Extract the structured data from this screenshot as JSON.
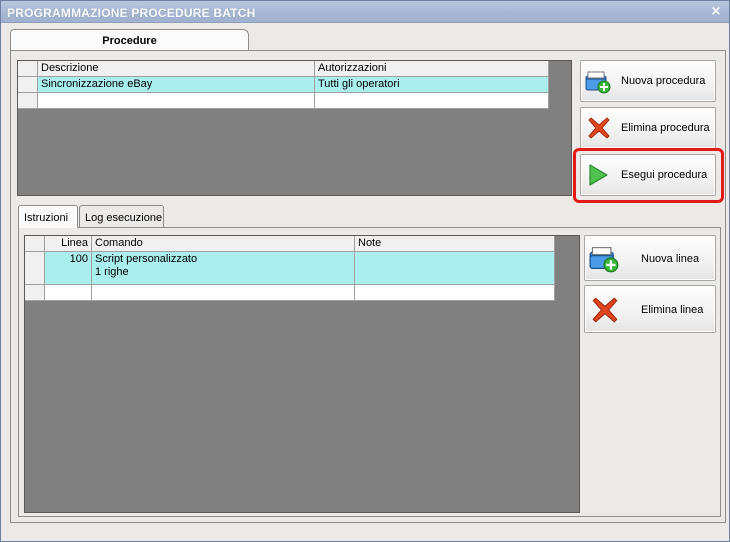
{
  "window": {
    "title": "PROGRAMMAZIONE PROCEDURE BATCH",
    "close_glyph": "×"
  },
  "main_tab": {
    "label": "Procedure"
  },
  "procedures": {
    "headers": [
      "Descrizione",
      "Autorizzazioni"
    ],
    "rows": [
      {
        "descrizione": "Sincronizzazione eBay",
        "autorizzazioni": "Tutti gli operatori"
      }
    ]
  },
  "procedure_buttons": {
    "new": "Nuova procedura",
    "delete": "Elimina procedura",
    "run": "Esegui procedura"
  },
  "sub_tabs": [
    "Istruzioni",
    "Log esecuzione"
  ],
  "instructions": {
    "headers": [
      "Linea",
      "Comando",
      "Note"
    ],
    "rows": [
      {
        "linea": "100",
        "comando_line1": "Script personalizzato",
        "comando_line2": "1 righe",
        "note": ""
      }
    ]
  },
  "line_buttons": {
    "new": "Nuova linea",
    "delete": "Elimina linea"
  },
  "colors": {
    "selected_row": "#aaeeee",
    "highlight": "#e01919",
    "grid_bg": "#808080"
  },
  "icons": [
    "add-folder-icon",
    "delete-x-icon",
    "play-icon"
  ]
}
